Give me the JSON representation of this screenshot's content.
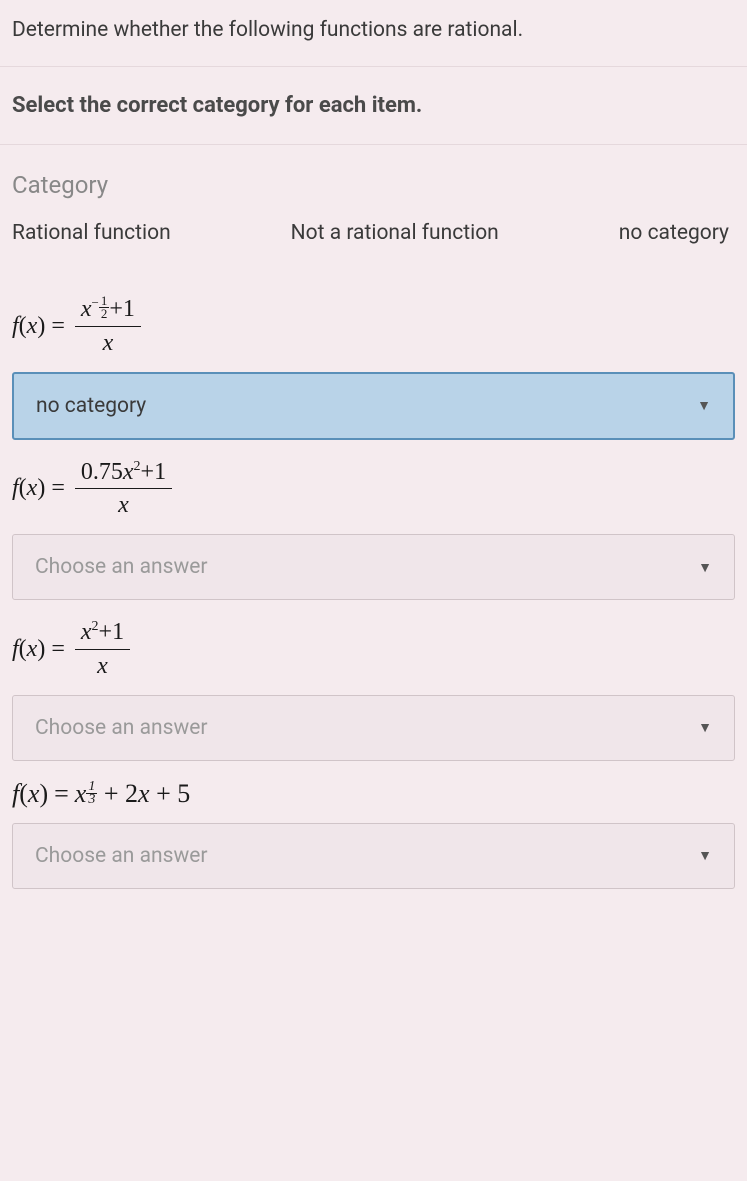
{
  "question": "Determine whether the following functions are rational.",
  "instruction": "Select the correct category for each item.",
  "category_label": "Category",
  "categories": {
    "rational": "Rational function",
    "not_rational": "Not a rational function",
    "none": "no category"
  },
  "placeholder": "Choose an answer",
  "items": [
    {
      "formula_prefix": "f(x) = ",
      "numerator_base": "x",
      "numerator_exp_neg": "−",
      "numerator_exp_num": "1",
      "numerator_exp_den": "2",
      "numerator_suffix": "+1",
      "denominator": "x",
      "selected": "no category"
    },
    {
      "formula_prefix": "f(x) = ",
      "numerator": "0.75x²+1",
      "denominator": "x",
      "selected": ""
    },
    {
      "formula_prefix": "f(x) = ",
      "numerator": "x²+1",
      "denominator": "x",
      "selected": ""
    },
    {
      "formula_prefix": "f(x) = ",
      "term1_base": "x",
      "term1_exp_num": "1",
      "term1_exp_den": "3",
      "term_rest": " + 2x + 5",
      "selected": ""
    }
  ]
}
